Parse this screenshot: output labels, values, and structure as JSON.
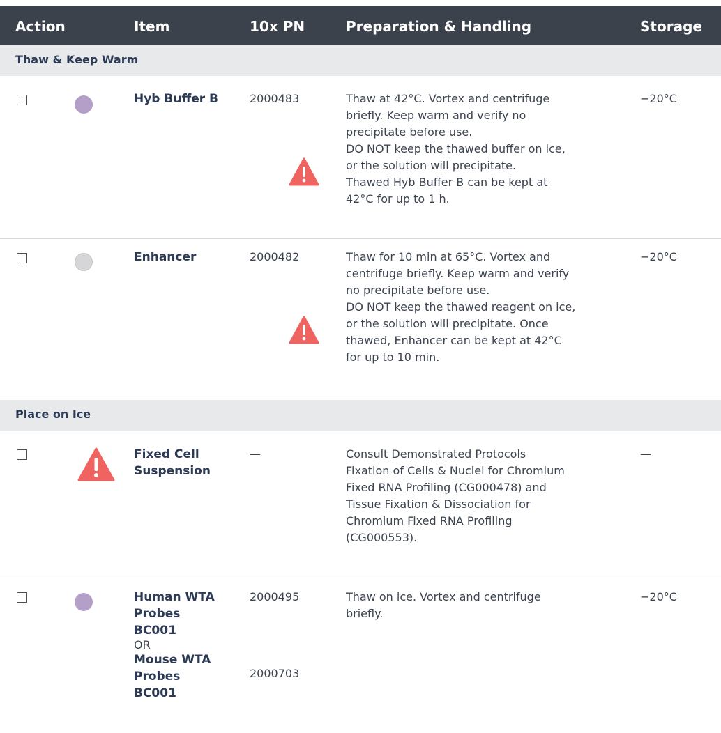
{
  "header": {
    "action": "Action",
    "item": "Item",
    "pn": "10x PN",
    "prep": "Preparation & Handling",
    "storage": "Storage"
  },
  "sections": {
    "thaw": "Thaw & Keep Warm",
    "ice": "Place on Ice"
  },
  "colors": {
    "header_bg": "#3c424c",
    "section_bg": "#e8e9eb",
    "purple_dot": "#b49fc8",
    "gray_dot": "#d6d6d8",
    "warning": "#ef6461"
  },
  "rows": {
    "hyb": {
      "item": "Hyb Buffer B",
      "pn": "2000483",
      "prep": [
        "Thaw at 42°C. Vortex and centrifuge",
        "briefly. Keep warm and verify no",
        "precipitate before use.",
        "DO NOT keep the thawed buffer on ice,",
        "or the solution will precipitate.",
        "Thawed Hyb Buffer B can be kept at",
        "42°C for up to 1 h."
      ],
      "storage": "−20°C",
      "icon": "purple-dot"
    },
    "enh": {
      "item": "Enhancer",
      "pn": "2000482",
      "prep": [
        "Thaw for 10 min at 65°C. Vortex and",
        "centrifuge briefly. Keep warm and verify",
        "no precipitate before use.",
        "DO NOT keep the thawed reagent on ice,",
        "or the solution will precipitate. Once",
        "thawed, Enhancer can be kept at 42°C",
        "for up to 10 min."
      ],
      "storage": "−20°C",
      "icon": "gray-dot"
    },
    "fixed": {
      "item": [
        "Fixed Cell",
        "Suspension"
      ],
      "pn": "—",
      "prep": [
        "Consult Demonstrated Protocols",
        "Fixation of Cells & Nuclei for Chromium",
        "Fixed RNA Profiling (CG000478) and",
        "Tissue Fixation & Dissociation for",
        "Chromium Fixed RNA Profiling",
        "(CG000553)."
      ],
      "storage": "—",
      "icon": "warning-icon"
    },
    "wta": {
      "item_human": [
        "Human WTA",
        "Probes",
        "BC001"
      ],
      "or": "OR",
      "item_mouse": [
        "Mouse WTA",
        "Probes",
        "BC001"
      ],
      "pn_human": "2000495",
      "pn_mouse": "2000703",
      "prep": [
        "Thaw on ice. Vortex and centrifuge",
        "briefly."
      ],
      "storage": "−20°C",
      "icon": "purple-dot"
    }
  }
}
